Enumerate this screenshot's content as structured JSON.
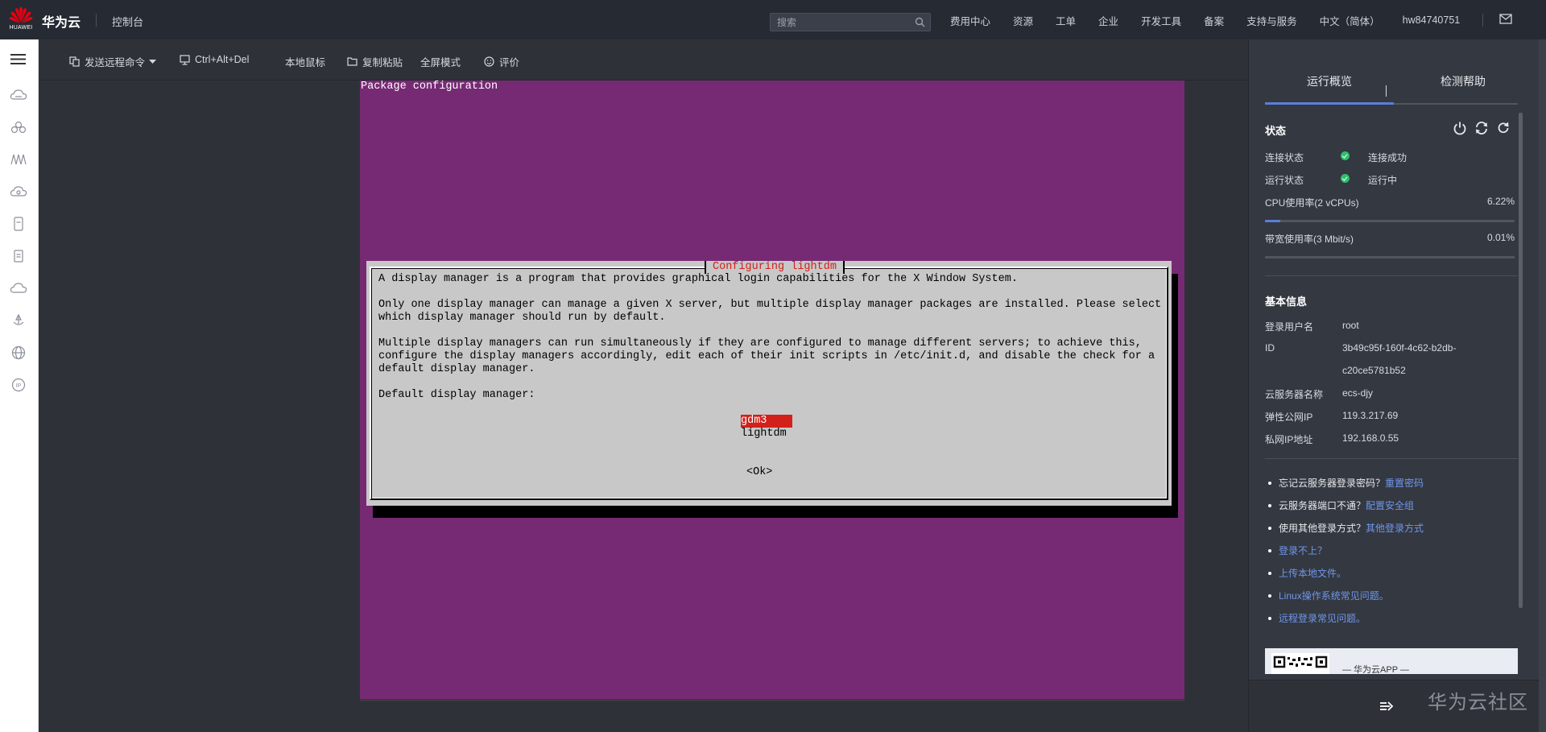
{
  "topbar": {
    "logo_text": "HUAWEI",
    "brand": "华为云",
    "console": "控制台",
    "search_placeholder": "搜索",
    "nav": [
      "费用中心",
      "资源",
      "工单",
      "企业",
      "开发工具",
      "备案",
      "支持与服务",
      "中文（简体）",
      "hw84740751"
    ]
  },
  "toolbar": {
    "send_command": "发送远程命令",
    "ctrl_alt_del": "Ctrl+Alt+Del",
    "local_mouse": "本地鼠标",
    "copy_paste": "复制粘贴",
    "fullscreen": "全屏模式",
    "rate": "评价"
  },
  "terminal": {
    "header": "Package configuration",
    "dialog_title": "Configuring lightdm",
    "lines": [
      "A display manager is a program that provides graphical login capabilities for the X Window System.",
      "Only one display manager can manage a given X server, but multiple display manager packages are installed. Please select",
      "which display manager should run by default.",
      "Multiple display managers can run simultaneously if they are configured to manage different servers; to achieve this,",
      "configure the display managers accordingly, edit each of their init scripts in /etc/init.d, and disable the check for a",
      "default display manager.",
      "Default display manager:"
    ],
    "options": [
      "gdm3",
      "lightdm"
    ],
    "selected_option": "gdm3",
    "ok_button": "<Ok>"
  },
  "panel": {
    "tabs": [
      "运行概览",
      "检测帮助"
    ],
    "status": {
      "title": "状态",
      "connection_label": "连接状态",
      "connection_value": "连接成功",
      "run_label": "运行状态",
      "run_value": "运行中",
      "cpu_label": "CPU使用率(2 vCPUs)",
      "cpu_value": "6.22%",
      "cpu_fraction": 0.0622,
      "bw_label": "带宽使用率(3 Mbit/s)",
      "bw_value": "0.01%",
      "bw_fraction": 0.0001,
      "status_color": "#2cbf6c",
      "accent_color": "#5b7ed8"
    },
    "basic": {
      "title": "基本信息",
      "user_label": "登录用户名",
      "user_value": "root",
      "id_label": "ID",
      "id_value_1": "3b49c95f-160f-4c62-b2db-",
      "id_value_2": "c20ce5781b52",
      "name_label": "云服务器名称",
      "name_value": "ecs-djy",
      "eip_label": "弹性公网IP",
      "eip_value": "119.3.217.69",
      "pip_label": "私网IP地址",
      "pip_value": "192.168.0.55"
    },
    "help": [
      {
        "text": "忘记云服务器登录密码？",
        "link": "重置密码"
      },
      {
        "text": "云服务器端口不通？",
        "link": "配置安全组"
      },
      {
        "text": "使用其他登录方式？",
        "link": "其他登录方式"
      },
      {
        "text": "",
        "link": "登录不上？"
      },
      {
        "text": "",
        "link": "上传本地文件。"
      },
      {
        "text": "",
        "link": "Linux操作系统常见问题。"
      },
      {
        "text": "",
        "link": "远程登录常见问题。"
      }
    ],
    "app_label": "— 华为云APP —"
  },
  "watermark": "华为云社区"
}
